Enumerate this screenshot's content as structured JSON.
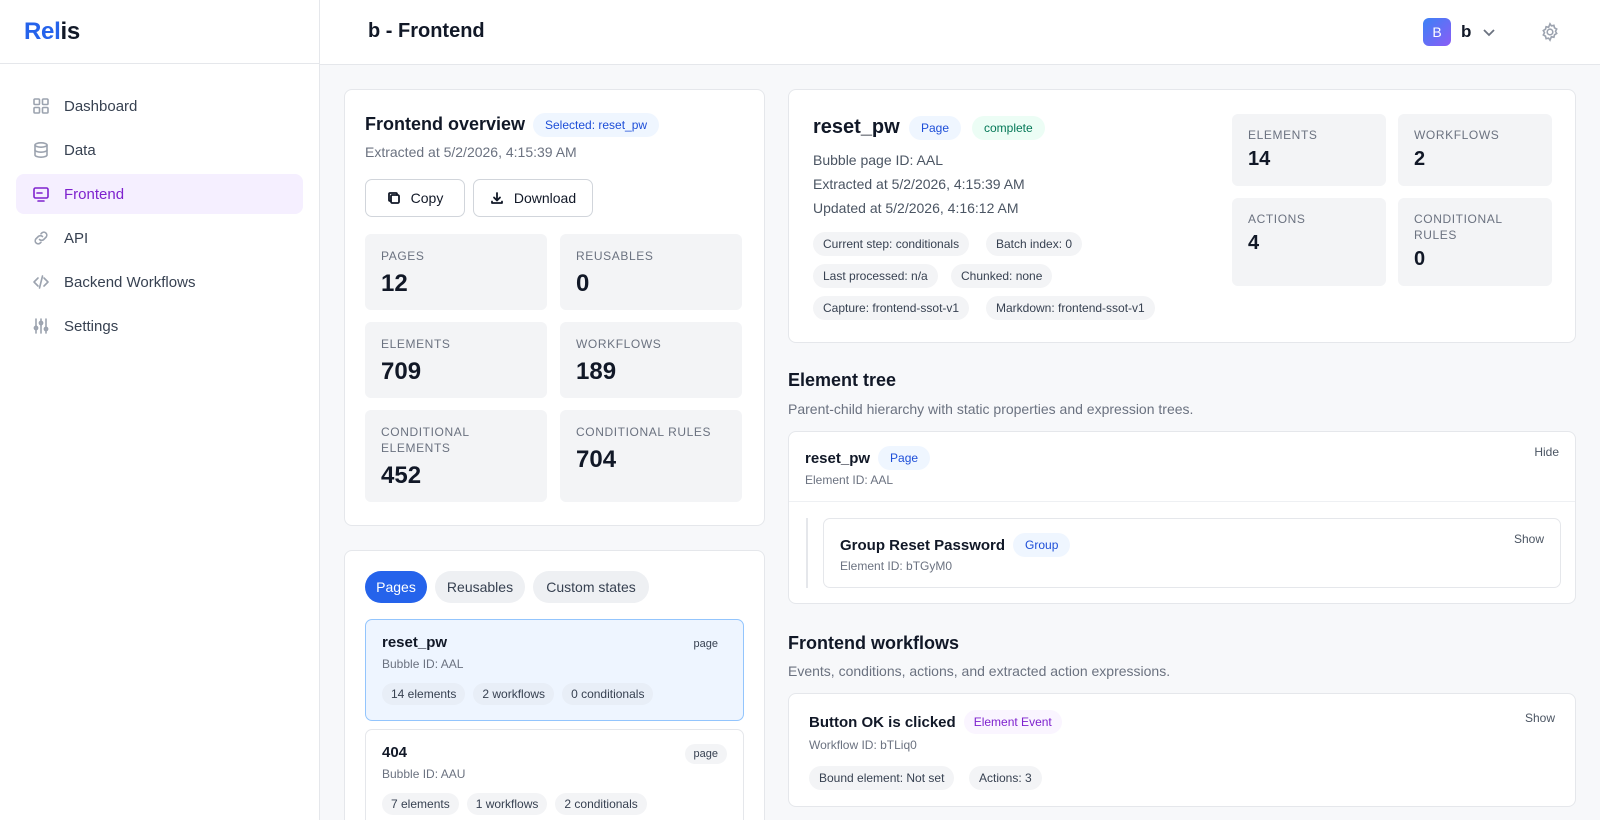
{
  "app": {
    "brand_part1": "Rel",
    "brand_part2": "is"
  },
  "sidebar": {
    "items": [
      {
        "label": "Dashboard",
        "icon": "grid-icon"
      },
      {
        "label": "Data",
        "icon": "database-icon"
      },
      {
        "label": "Frontend",
        "icon": "monitor-icon",
        "active": true
      },
      {
        "label": "API",
        "icon": "link-icon"
      },
      {
        "label": "Backend Workflows",
        "icon": "code-icon"
      },
      {
        "label": "Settings",
        "icon": "sliders-icon"
      }
    ]
  },
  "header": {
    "title": "b - Frontend",
    "user": {
      "avatar_letter": "B",
      "name": "b"
    }
  },
  "overview": {
    "title": "Frontend overview",
    "selected_badge": "Selected: reset_pw",
    "extracted": "Extracted at 5/2/2026, 4:15:39 AM",
    "copy_label": "Copy",
    "download_label": "Download",
    "stats": [
      {
        "label": "PAGES",
        "value": "12"
      },
      {
        "label": "REUSABLES",
        "value": "0"
      },
      {
        "label": "ELEMENTS",
        "value": "709"
      },
      {
        "label": "WORKFLOWS",
        "value": "189"
      },
      {
        "label": "CONDITIONAL ELEMENTS",
        "value": "452"
      },
      {
        "label": "CONDITIONAL RULES",
        "value": "704"
      }
    ]
  },
  "list": {
    "tabs": [
      "Pages",
      "Reusables",
      "Custom states"
    ],
    "active_tab": "Pages",
    "pages": [
      {
        "name": "reset_pw",
        "bubble_id": "Bubble ID: AAL",
        "type": "page",
        "chips": [
          "14 elements",
          "2 workflows",
          "0 conditionals"
        ],
        "selected": true
      },
      {
        "name": "404",
        "bubble_id": "Bubble ID: AAU",
        "type": "page",
        "chips": [
          "7 elements",
          "1 workflows",
          "2 conditionals"
        ],
        "selected": false
      }
    ]
  },
  "detail": {
    "name": "reset_pw",
    "kind_badge": "Page",
    "status_badge": "complete",
    "bubble_page_id": "Bubble page ID: AAL",
    "extracted": "Extracted at 5/2/2026, 4:15:39 AM",
    "updated": "Updated at 5/2/2026, 4:16:12 AM",
    "chips": [
      "Current step: conditionals",
      "Batch index: 0",
      "Last processed: n/a",
      "Chunked: none",
      "Capture: frontend-ssot-v1",
      "Markdown: frontend-ssot-v1"
    ],
    "stats": [
      {
        "label": "ELEMENTS",
        "value": "14"
      },
      {
        "label": "WORKFLOWS",
        "value": "2"
      },
      {
        "label": "ACTIONS",
        "value": "4"
      },
      {
        "label": "CONDITIONAL RULES",
        "value": "0"
      }
    ]
  },
  "element_tree": {
    "title": "Element tree",
    "subtitle": "Parent-child hierarchy with static properties and expression trees.",
    "root": {
      "name": "reset_pw",
      "badge": "Page",
      "id": "Element ID: AAL",
      "toggle": "Hide"
    },
    "child": {
      "name": "Group Reset Password",
      "badge": "Group",
      "id": "Element ID: bTGyM0",
      "toggle": "Show"
    }
  },
  "workflows": {
    "title": "Frontend workflows",
    "subtitle": "Events, conditions, actions, and extracted action expressions.",
    "items": [
      {
        "name": "Button OK is clicked",
        "badge": "Element Event",
        "id": "Workflow ID: bTLiq0",
        "toggle": "Show",
        "chips": [
          "Bound element: Not set",
          "Actions: 3"
        ]
      }
    ]
  }
}
